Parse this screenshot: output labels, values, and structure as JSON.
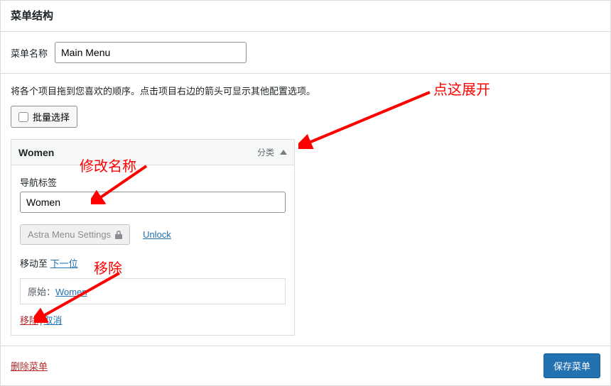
{
  "header": {
    "title": "菜单结构"
  },
  "name_row": {
    "label": "菜单名称",
    "value": "Main Menu"
  },
  "instructions": "将各个项目拖到您喜欢的顺序。点击项目右边的箭头可显示其他配置选项。",
  "bulk_select_label": "批量选择",
  "item": {
    "title": "Women",
    "type_label": "分类",
    "nav_label_caption": "导航标签",
    "nav_label_value": "Women",
    "astra_label": "Astra Menu Settings",
    "unlock_label": "Unlock",
    "move_to_label": "移动至",
    "move_next_label": "下一位",
    "original_label": "原始：",
    "original_link": "Women",
    "remove_label": "移除",
    "cancel_label": "取消"
  },
  "footer": {
    "delete_label": "删除菜单",
    "save_label": "保存菜单"
  },
  "annotations": {
    "expand": "点这展开",
    "rename": "修改名称",
    "remove": "移除"
  }
}
